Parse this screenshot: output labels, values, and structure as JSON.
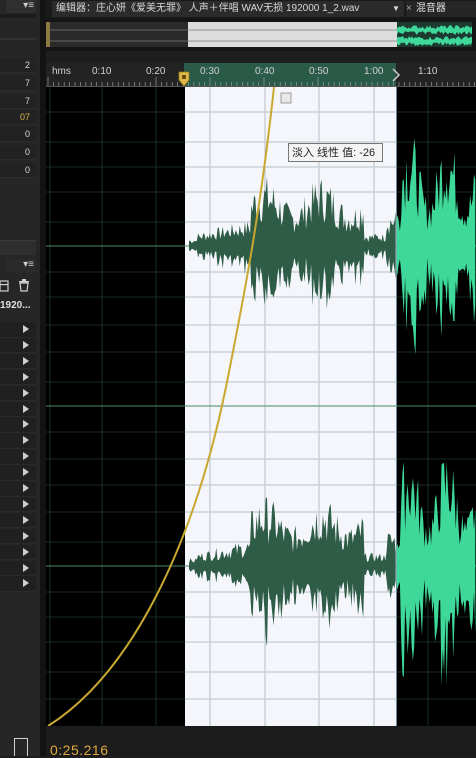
{
  "editor": {
    "tab_title": "编辑器：庄心妍《爱美无罪》 人声＋伴唱  WAV无损  192000  1_2.wav",
    "tab_dropdown": "▼",
    "tab_close": "×",
    "mixer_tab": "混音器"
  },
  "left_panel": {
    "menu_glyph": "▾≡",
    "values": [
      "2",
      "7",
      "7",
      "07",
      "0",
      "0",
      "0"
    ],
    "highlight_index": 3,
    "second_menu_glyph": "▾≡",
    "file_label": "1920..."
  },
  "ruler": {
    "unit_label": "hms",
    "ticks": [
      "0:10",
      "0:20",
      "0:30",
      "0:40",
      "0:50",
      "1:00",
      "1:10"
    ]
  },
  "fade_tooltip": "淡入 线性 值: -26",
  "current_time": "0:25.216",
  "colors": {
    "accent": "#e0a840",
    "waveform": "#2f5c46",
    "waveform_bright": "#3ed99a",
    "selection": "#f4f6fb",
    "fade_curve": "#c9a830"
  }
}
